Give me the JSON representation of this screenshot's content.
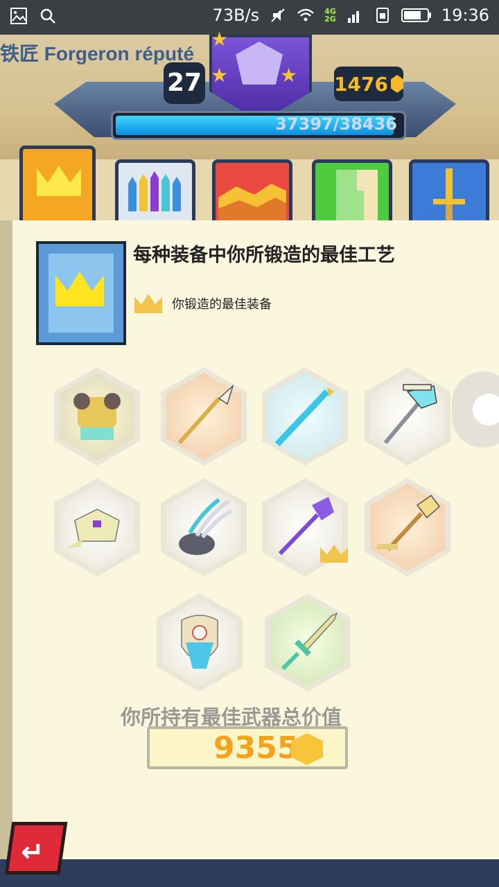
{
  "status_bar": {
    "speed": "73B/s",
    "network_top": "4G",
    "network_bottom": "2G",
    "time": "19:36"
  },
  "header": {
    "rank_title": "铁匠 Forgeron réputé",
    "level": "27",
    "gems": "1476",
    "xp_current": "37397",
    "xp_max": "38436",
    "xp_progress_fraction": 0.973
  },
  "tabs": [
    {
      "name": "crown",
      "active": true
    },
    {
      "name": "fence",
      "active": false
    },
    {
      "name": "mountains",
      "active": false
    },
    {
      "name": "map",
      "active": false
    },
    {
      "name": "sword",
      "active": false
    }
  ],
  "page": {
    "section_title": "每种装备中你所锻造的最佳工艺",
    "legend_label": "你锻造的最佳装备",
    "items": [
      {
        "name": "armor",
        "glyph": "🛡",
        "style": "pale"
      },
      {
        "name": "spear",
        "glyph": "⟋",
        "style": "orange"
      },
      {
        "name": "staff",
        "glyph": "⟋",
        "style": "cyan"
      },
      {
        "name": "axe",
        "glyph": "⚒",
        "style": "pale"
      },
      {
        "name": "shield",
        "glyph": "◈",
        "style": "pale"
      },
      {
        "name": "claws",
        "glyph": "⟆",
        "style": "pale"
      },
      {
        "name": "scepter",
        "glyph": "⟋",
        "style": "pale",
        "crowned": true
      },
      {
        "name": "shovel",
        "glyph": "⚒",
        "style": "orange"
      },
      {
        "name": "breastplate",
        "glyph": "⛉",
        "style": "pale"
      },
      {
        "name": "sword",
        "glyph": "🗡",
        "style": "green"
      }
    ],
    "total_label": "你所持有最佳武器总价值",
    "total_value": "9355"
  },
  "colors": {
    "accent_gold": "#f2a21b",
    "xp_blue": "#42d6ff",
    "back_red": "#e02a3a"
  }
}
